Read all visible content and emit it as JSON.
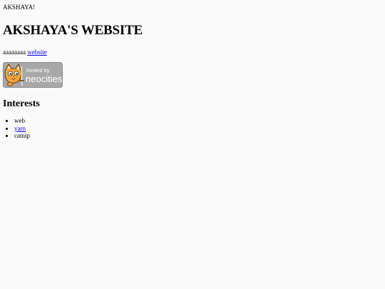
{
  "header": {
    "greeting": "AKSHAYA!",
    "title": "AKSHAYA'S WEBSITE"
  },
  "tagline": {
    "prefix": "aaaaaaaa ",
    "link_text": "website"
  },
  "badge": {
    "label_line1": "hosted by",
    "label_line2": "neocities",
    "icon": "neocities-cat-icon",
    "bg_color": "#a8a8a8",
    "text_color": "#ffffff",
    "accent_color": "#f2a23a"
  },
  "interests": {
    "heading": "Interests",
    "items": [
      {
        "label": "web",
        "link": false
      },
      {
        "label": "yarn",
        "link": true
      },
      {
        "label": "catnip",
        "link": false
      }
    ]
  },
  "colors": {
    "link": "#0000ee",
    "background": "#fafafa"
  }
}
